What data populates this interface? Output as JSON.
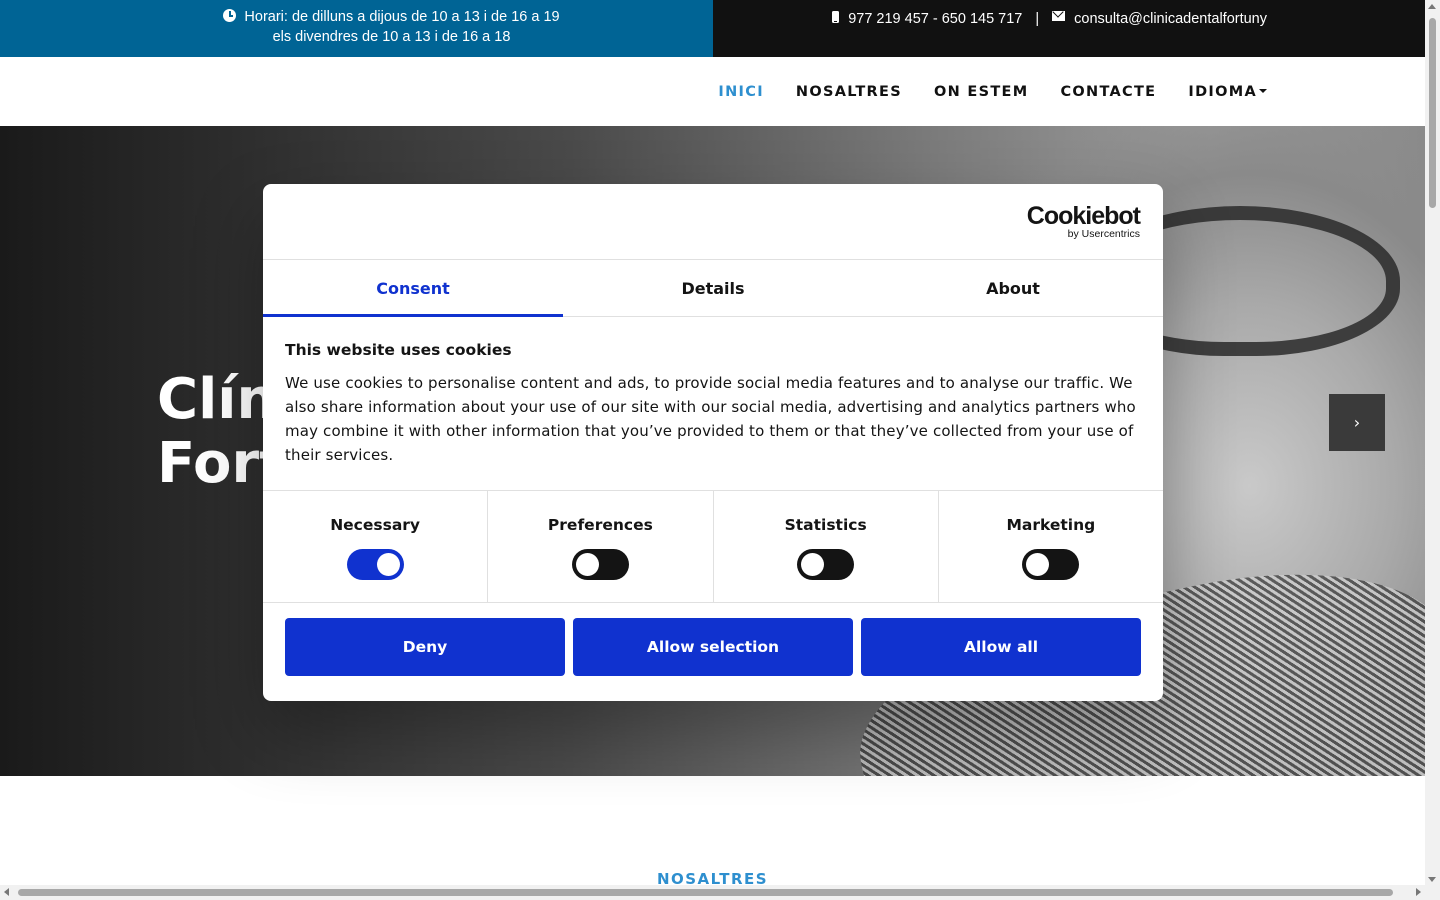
{
  "topbar": {
    "hours_line1": "Horari: de dilluns a dijous de 10 a 13 i de 16 a 19",
    "hours_line2": "els divendres de 10 a 13 i de 16 a 18",
    "phone": "977 219 457 - 650 145 717",
    "separator": "|",
    "email": "consulta@clinicadentalfortuny"
  },
  "nav": {
    "items": [
      {
        "label": "INICI"
      },
      {
        "label": "NOSALTRES"
      },
      {
        "label": "ON ESTEM"
      },
      {
        "label": "CONTACTE"
      },
      {
        "label": "IDIOMA"
      }
    ]
  },
  "hero": {
    "title_line1": "Clín",
    "title_line2": "Fort",
    "next_label": "›"
  },
  "section": {
    "heading": "NOSALTRES"
  },
  "cookie": {
    "logo_main": "Cookiebot",
    "logo_sub": "by Usercentrics",
    "tabs": [
      {
        "label": "Consent"
      },
      {
        "label": "Details"
      },
      {
        "label": "About"
      }
    ],
    "title": "This website uses cookies",
    "text": "We use cookies to personalise content and ads, to provide social media features and to analyse our traffic. We also share information about your use of our site with our social media, advertising and analytics partners who may combine it with other information that you’ve provided to them or that they’ve collected from your use of their services.",
    "toggles": [
      {
        "label": "Necessary",
        "on": true
      },
      {
        "label": "Preferences",
        "on": false
      },
      {
        "label": "Statistics",
        "on": false
      },
      {
        "label": "Marketing",
        "on": false
      }
    ],
    "buttons": {
      "deny": "Deny",
      "allow_selection": "Allow selection",
      "allow_all": "Allow all"
    },
    "accent_color": "#1032cf"
  },
  "colors": {
    "topbar_blue": "#006495",
    "topbar_dark": "#111111",
    "nav_active": "#2e8fcf"
  }
}
